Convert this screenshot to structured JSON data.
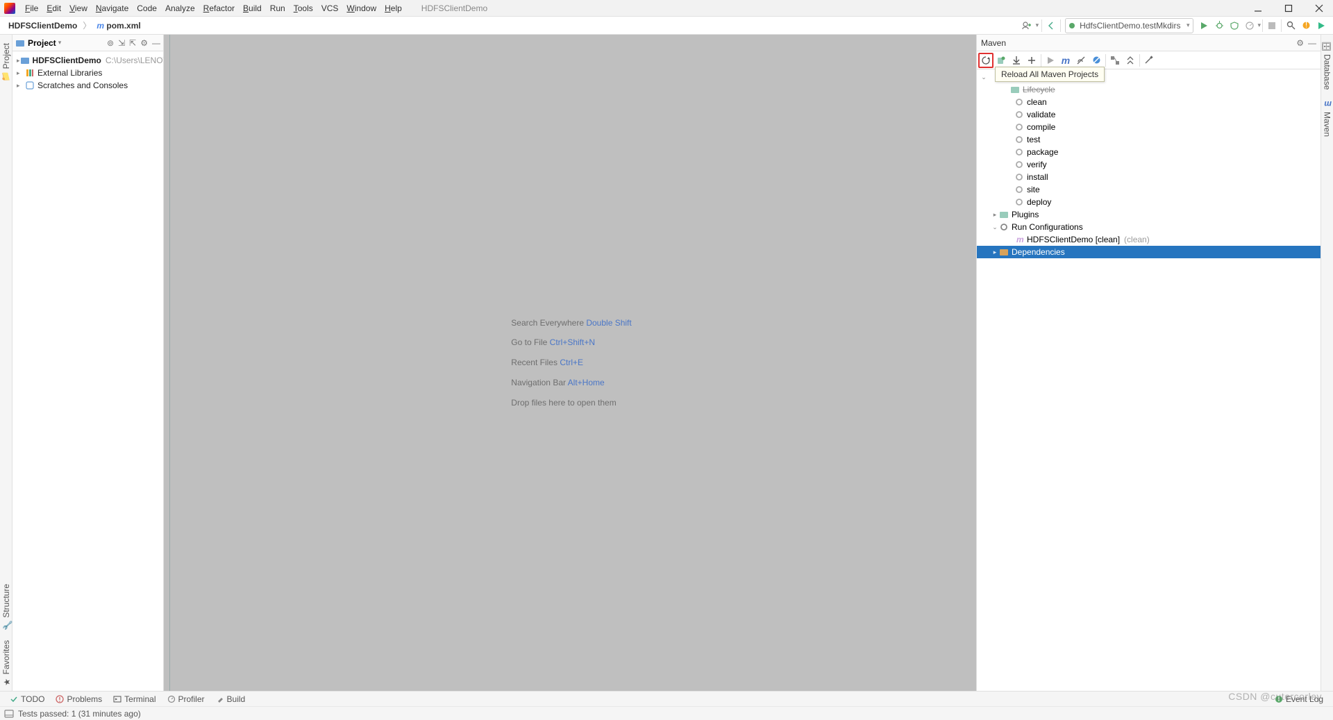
{
  "menubar": {
    "file": "File",
    "edit": "Edit",
    "view": "View",
    "navigate": "Navigate",
    "code": "Code",
    "analyze": "Analyze",
    "refactor": "Refactor",
    "build": "Build",
    "run": "Run",
    "tools": "Tools",
    "vcs": "VCS",
    "window": "Window",
    "help": "Help"
  },
  "app_title": "HDFSClientDemo",
  "breadcrumb": {
    "root": "HDFSClientDemo",
    "file": "pom.xml"
  },
  "run_config": "HdfsClientDemo.testMkdirs",
  "project_panel": {
    "title": "Project",
    "items": [
      {
        "label": "HDFSClientDemo",
        "hint": "C:\\Users\\LENOVO"
      },
      {
        "label": "External Libraries"
      },
      {
        "label": "Scratches and Consoles"
      }
    ]
  },
  "editor_hints": [
    {
      "text": "Search Everywhere",
      "shortcut": "Double Shift"
    },
    {
      "text": "Go to File",
      "shortcut": "Ctrl+Shift+N"
    },
    {
      "text": "Recent Files",
      "shortcut": "Ctrl+E"
    },
    {
      "text": "Navigation Bar",
      "shortcut": "Alt+Home"
    },
    {
      "text": "Drop files here to open them",
      "shortcut": ""
    }
  ],
  "maven": {
    "title": "Maven",
    "tooltip": "Reload All Maven Projects",
    "lifecycle_label": "Lifecycle",
    "lifecycle": [
      "clean",
      "validate",
      "compile",
      "test",
      "package",
      "verify",
      "install",
      "site",
      "deploy"
    ],
    "plugins": "Plugins",
    "run_cfg": "Run Configurations",
    "run_item": {
      "name": "HDFSClientDemo [clean]",
      "hint": "(clean)"
    },
    "deps": "Dependencies"
  },
  "left_tabs": {
    "project": "Project",
    "structure": "Structure",
    "favorites": "Favorites"
  },
  "right_tabs": {
    "database": "Database",
    "maven": "Maven"
  },
  "bottom": {
    "todo": "TODO",
    "problems": "Problems",
    "terminal": "Terminal",
    "profiler": "Profiler",
    "build": "Build",
    "event_log": "Event Log"
  },
  "status": "Tests passed: 1 (31 minutes ago)",
  "watermark": "CSDN @cutercorley"
}
